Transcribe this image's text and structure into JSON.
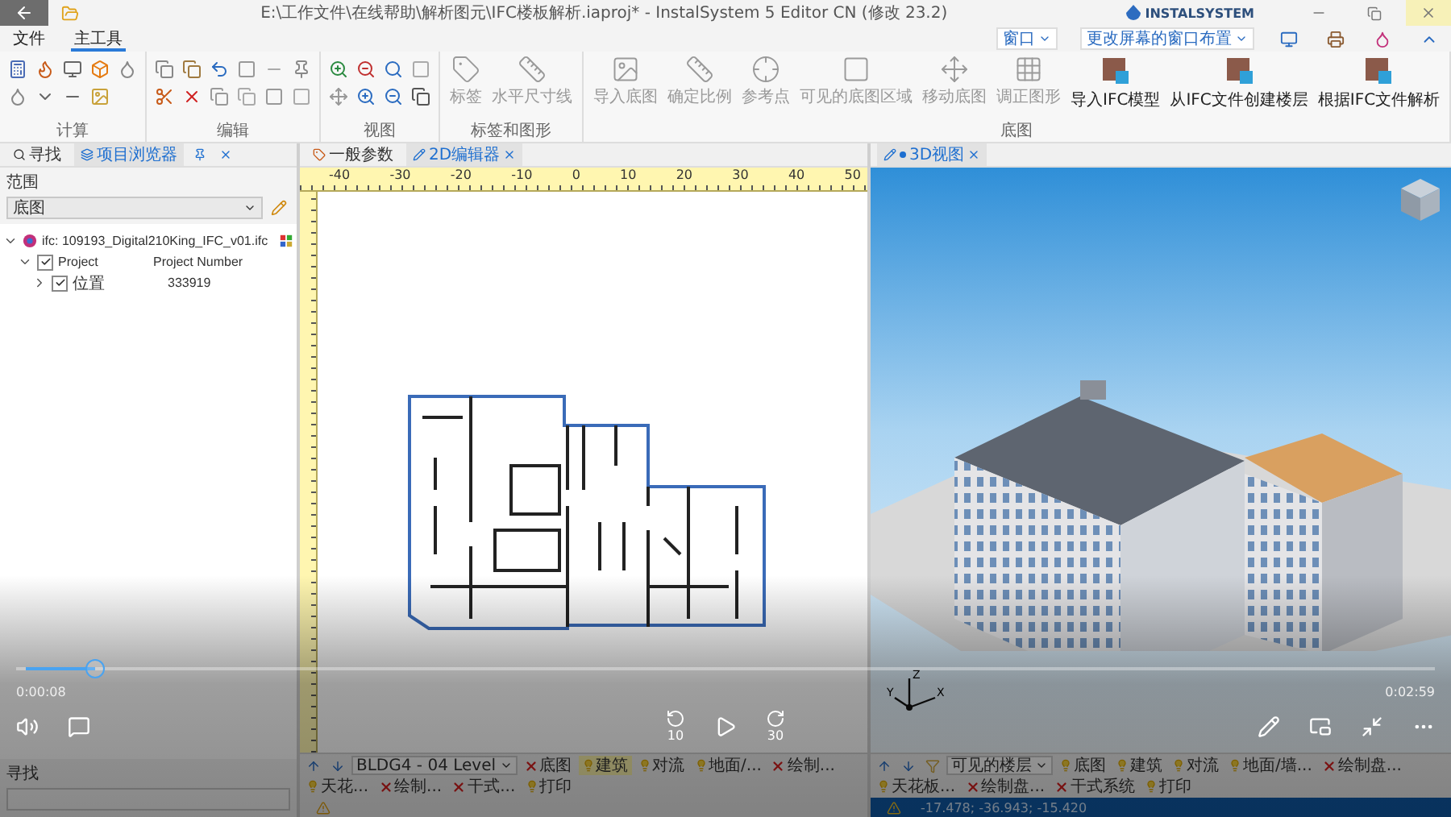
{
  "window": {
    "title": "E:\\工作文件\\在线帮助\\解析图元\\IFC楼板解析.iaproj* - InstalSystem 5 Editor CN (修改 23.2)",
    "logo": "INSTALSYSTEM"
  },
  "ribbon": {
    "tabs": [
      {
        "label": "文件",
        "selected": false
      },
      {
        "label": "主工具",
        "selected": true
      }
    ],
    "right_menus": [
      "窗口",
      "更改屏幕的窗口布置"
    ],
    "groups": [
      {
        "label": "计算",
        "kind": "small"
      },
      {
        "label": "编辑",
        "kind": "small"
      },
      {
        "label": "视图",
        "kind": "small"
      },
      {
        "label": "标签和图形",
        "kind": "large",
        "buttons": [
          {
            "label": "标签",
            "disabled": true
          },
          {
            "label": "水平尺寸线",
            "disabled": true
          }
        ]
      },
      {
        "label": "底图",
        "kind": "large",
        "buttons": [
          {
            "label": "导入底图",
            "disabled": true
          },
          {
            "label": "确定比例",
            "disabled": true
          },
          {
            "label": "参考点",
            "disabled": true
          },
          {
            "label": "可见的底图区域",
            "disabled": true
          },
          {
            "label": "移动底图",
            "disabled": true
          },
          {
            "label": "调正图形",
            "disabled": true
          },
          {
            "label": "导入IFC模型",
            "disabled": false
          },
          {
            "label": "从IFC文件创建楼层",
            "disabled": false
          },
          {
            "label": "根据IFC文件解析",
            "disabled": false
          }
        ]
      }
    ]
  },
  "left_panel": {
    "tabs": [
      {
        "label": "寻找",
        "selected": false
      },
      {
        "label": "项目浏览器",
        "selected": true
      }
    ],
    "scope_label": "范围",
    "scope_value": "底图",
    "tree": [
      {
        "label": "ifc: 109193_Digital210King_IFC_v01.ifc",
        "expanded": true,
        "children": [
          {
            "label": "Project",
            "value": "Project Number",
            "checked": true,
            "expanded": true,
            "children": [
              {
                "label": "位置",
                "value": "333919",
                "checked": true,
                "expanded": false
              }
            ]
          }
        ]
      }
    ],
    "search_label": "寻找"
  },
  "editor": {
    "tabs": [
      {
        "label": "一般参数",
        "selected": false
      },
      {
        "label": "2D编辑器",
        "selected": true
      }
    ],
    "ruler": [
      "-40",
      "-30",
      "-20",
      "-10",
      "0",
      "10",
      "20",
      "30",
      "40",
      "50"
    ],
    "level_selector": "BLDG4 - 04 Level",
    "layers": [
      {
        "label": "底图",
        "visible": false,
        "selected": false
      },
      {
        "label": "建筑",
        "visible": true,
        "selected": true
      },
      {
        "label": "对流",
        "visible": true,
        "selected": false
      },
      {
        "label": "地面/...",
        "visible": true,
        "selected": false
      },
      {
        "label": "绘制...",
        "visible": false,
        "selected": false
      },
      {
        "label": "天花...",
        "visible": true,
        "selected": false
      },
      {
        "label": "绘制...",
        "visible": false,
        "selected": false
      },
      {
        "label": "干式...",
        "visible": false,
        "selected": false
      },
      {
        "label": "打印",
        "visible": true,
        "selected": false
      }
    ]
  },
  "view3d": {
    "tab": {
      "label": "3D视图",
      "modified": true
    },
    "axes": [
      "Z",
      "Y",
      "X"
    ],
    "floor_selector": "可见的楼层",
    "layers": [
      {
        "label": "底图",
        "visible": true,
        "selected": false
      },
      {
        "label": "建筑",
        "visible": true,
        "selected": false
      },
      {
        "label": "对流",
        "visible": true,
        "selected": false
      },
      {
        "label": "地面/墙...",
        "visible": true,
        "selected": false
      },
      {
        "label": "绘制盘...",
        "visible": false,
        "selected": false
      },
      {
        "label": "天花板...",
        "visible": true,
        "selected": false
      },
      {
        "label": "绘制盘...",
        "visible": false,
        "selected": false
      },
      {
        "label": "干式系统",
        "visible": false,
        "selected": false
      },
      {
        "label": "打印",
        "visible": true,
        "selected": false
      }
    ],
    "coordinates": "-17.478; -36.943; -15.420"
  },
  "video": {
    "level": 0.05,
    "elapsed": "0:00:08",
    "duration": "0:02:59",
    "skip_back": "10",
    "skip_forward": "30"
  }
}
